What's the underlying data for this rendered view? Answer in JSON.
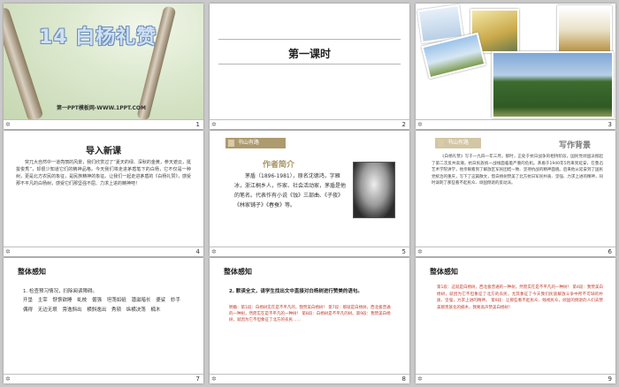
{
  "slides": [
    {
      "num": "1",
      "title": "14 白杨礼赞",
      "site": "第一PPT模板网-WWW.1PPT.COM"
    },
    {
      "num": "2",
      "heading": "第一课时"
    },
    {
      "num": "3"
    },
    {
      "num": "4",
      "heading": "导入新课",
      "text": "突兀大自然中一道亮丽的风景，我们欣赏过了“夏天的绿、深秋的金黄，参天遮云，挺拔俊秀”，却很少知道它们的精神品格。今天我们将走进茅盾笔下的白杨，它不仅是一种树，更是北方农民的象征，是民族精神的象征。让我们一起走进茅盾的《白杨礼赞》，感受那不平凡的白杨树，感受它们那坚强不屈、力求上进的精神吧！"
    },
    {
      "num": "5",
      "ribbon": "书山有路",
      "heading": "作者简介",
      "text": "茅盾（1896-1981），原名沈德鸿，字雁冰，浙江桐乡人，作家、社会活动家，茅盾是他的笔名。代表作有小说《蚀》三部曲、《子夜》《林家铺子》《春蚕》等。"
    },
    {
      "num": "6",
      "ribbon": "书山有路",
      "heading": "写作背景",
      "text": "《白杨礼赞》写于一九四一年三月。那时，正处于抗日战争的相持阶段，国民党顽固派掀起了第二次反共高潮，抗日民族统一战线面临着严重的危机。茅盾于1940年5月来到延安，在鲁迅艺术学院讲学，他亲眼看到了解放区军民团结一致、坚持抗战的精神面貌。后来他从延安到了国民党统治的重庆，写下了这篇散文，借白杨树赞美了北方抗日军民朴质、坚强、力求上进的精神，同时讽刺了那些看不起民众、顽固倒退的反动派。"
    },
    {
      "num": "7",
      "heading": "整体感知",
      "sub": "1. 检查预习情况，扫除阅读障碍。",
      "words": "开垦 主宰 恹恹欲睡 虬枝 倔强 坦荡如砥 潜滋暗长 婆娑 妙手偶得 无边无垠 旁逸斜出 横斜逸出 秀颀 纵横决荡 楠木"
    },
    {
      "num": "8",
      "heading": "整体感知",
      "question": "2. 默读全文，请学生找出文中直接对白杨树进行赞美的语句。",
      "answer": "明确：第1段：白杨树实在是不平凡的，我赞美白杨树！ 第7段：那就是白杨树，西北极普通的一种树，然而实在是不平凡的一种树！ 第8段：白杨树是不平凡的树。第9段：我赞美白杨树，就因为它不但象征了北方的农民……"
    },
    {
      "num": "9",
      "heading": "整体感知",
      "answer": "第1段：这就是白杨树，西北极普通的一种树，然而实在是不平凡的一种树！ 第4段：我赞美白杨树，就因为它不但象征了北方的农民，尤其象征了今天我们民族解放斗争中所不可缺的朴质、坚强，力求上进的精神。 第9段：让那些看不起民众、贱视民众，顽固的倒退的人们去赞美那贵族化的楠木，我要高声赞美白杨树！"
    }
  ]
}
